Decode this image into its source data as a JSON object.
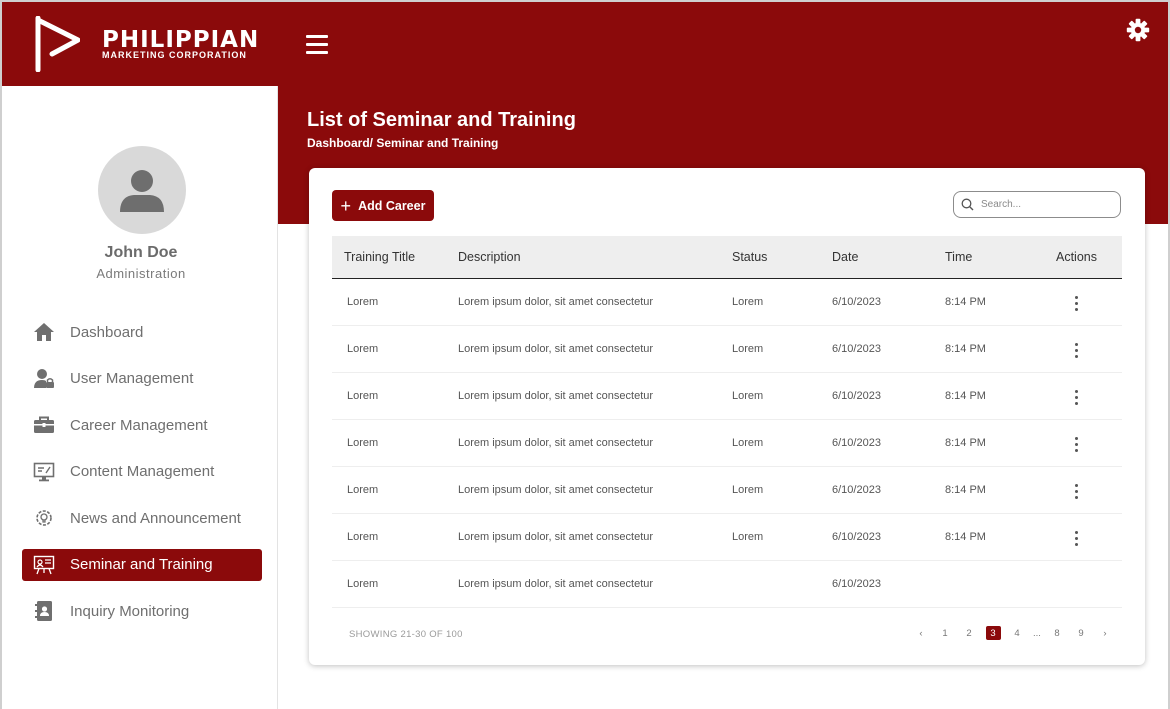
{
  "brand": {
    "name": "PHILIPPIAN",
    "subtitle": "MARKETING CORPORATION",
    "accent": "#8b0a0b"
  },
  "header": {
    "menu_icon": "hamburger-icon",
    "settings_icon": "gear-icon"
  },
  "user": {
    "name": "John Doe",
    "role": "Administration",
    "avatar_icon": "user-avatar-icon"
  },
  "sidebar": {
    "items": [
      {
        "label": "Dashboard",
        "icon": "home-icon",
        "active": false
      },
      {
        "label": "User Management",
        "icon": "user-lock-icon",
        "active": false
      },
      {
        "label": "Career Management",
        "icon": "briefcase-icon",
        "active": false
      },
      {
        "label": "Content Management",
        "icon": "monitor-icon",
        "active": false
      },
      {
        "label": "News and Announcement",
        "icon": "gear-bulb-icon",
        "active": false
      },
      {
        "label": "Seminar and Training",
        "icon": "presentation-icon",
        "active": true
      },
      {
        "label": "Inquiry Monitoring",
        "icon": "contact-book-icon",
        "active": false
      }
    ]
  },
  "main": {
    "title": "List of Seminar and Training",
    "breadcrumb": "Dashboard/ Seminar and Training",
    "add_button": "Add Career",
    "search_placeholder": "Search...",
    "table": {
      "headers": [
        "Training Title",
        "Description",
        "Status",
        "Date",
        "Time",
        "Actions"
      ],
      "rows": [
        {
          "title": "Lorem",
          "description": "Lorem ipsum dolor, sit amet consectetur",
          "status": "Lorem",
          "date": "6/10/2023",
          "time": "8:14 PM",
          "has_actions": true
        },
        {
          "title": "Lorem",
          "description": "Lorem ipsum dolor, sit amet consectetur",
          "status": "Lorem",
          "date": "6/10/2023",
          "time": "8:14 PM",
          "has_actions": true
        },
        {
          "title": "Lorem",
          "description": "Lorem ipsum dolor, sit amet consectetur",
          "status": "Lorem",
          "date": "6/10/2023",
          "time": "8:14 PM",
          "has_actions": true
        },
        {
          "title": "Lorem",
          "description": "Lorem ipsum dolor, sit amet consectetur",
          "status": "Lorem",
          "date": "6/10/2023",
          "time": "8:14 PM",
          "has_actions": true
        },
        {
          "title": "Lorem",
          "description": "Lorem ipsum dolor, sit amet consectetur",
          "status": "Lorem",
          "date": "6/10/2023",
          "time": "8:14 PM",
          "has_actions": true
        },
        {
          "title": "Lorem",
          "description": "Lorem ipsum dolor, sit amet consectetur",
          "status": "Lorem",
          "date": "6/10/2023",
          "time": "8:14 PM",
          "has_actions": true
        },
        {
          "title": "Lorem",
          "description": "Lorem ipsum dolor, sit amet consectetur",
          "status": "",
          "date": "6/10/2023",
          "time": "",
          "has_actions": false
        }
      ]
    },
    "showing_text": "SHOWING 21-30 OF 100",
    "pagination": {
      "prev": "‹",
      "pages": [
        "1",
        "2",
        "3",
        "4",
        "...",
        "8",
        "9"
      ],
      "current": "3",
      "next": "›"
    }
  }
}
